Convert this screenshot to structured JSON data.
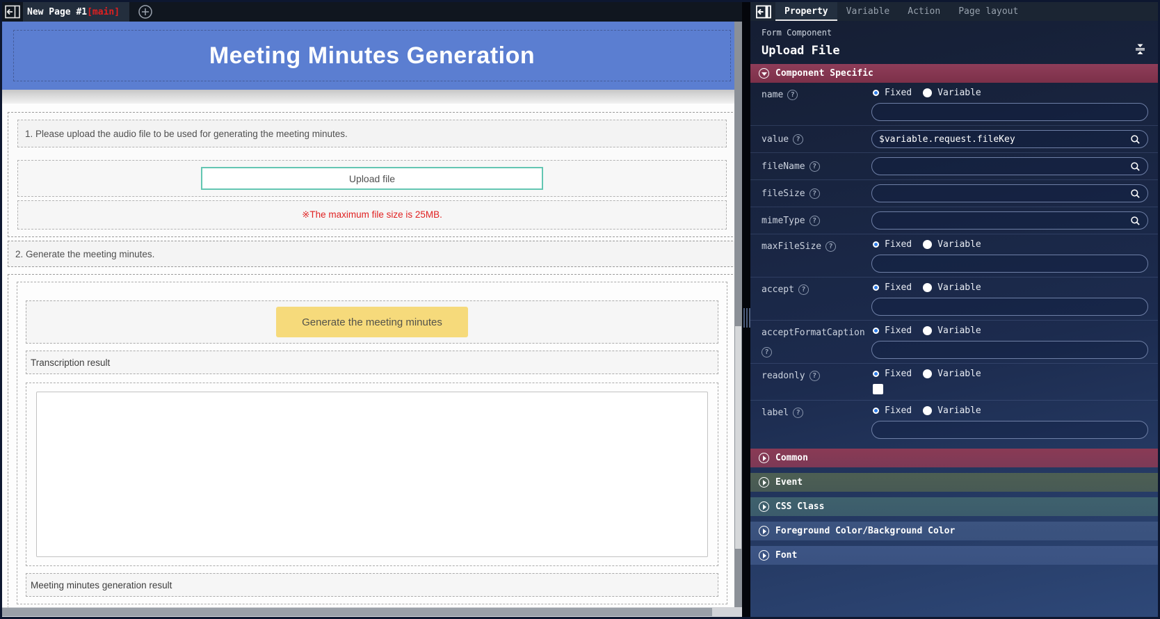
{
  "left_window": {
    "tab_bar": {
      "tab_label": "New Page #1",
      "tab_badge": "[main]"
    },
    "banner": {
      "title": "Meeting Minutes Generation",
      "background": "#5b7ed1"
    },
    "canvas": {
      "instruction_1": "1. Please upload the audio file to be used for generating the meeting minutes.",
      "upload_button_label": "Upload file",
      "file_size_note": "※The maximum file size is 25MB.",
      "instruction_2": "2. Generate the meeting minutes.",
      "generate_button_label": "Generate the meeting minutes",
      "transcription_label": "Transcription result",
      "minutes_label": "Meeting minutes generation result",
      "accent_colors": {
        "upload_border": "#63c6b2",
        "generate_bg": "#f6da7b",
        "note_text": "#e02222",
        "banner_blue": "#5b7ed1"
      }
    }
  },
  "right_panel": {
    "tabs": [
      {
        "label": "Property",
        "active": true
      },
      {
        "label": "Variable",
        "active": false
      },
      {
        "label": "Action",
        "active": false
      },
      {
        "label": "Page layout",
        "active": false
      }
    ],
    "component_type": "Form Component",
    "component_name": "Upload File",
    "radio_options": [
      "Fixed",
      "Variable"
    ],
    "component_specific": {
      "title": "Component Specific",
      "header_color": "#8e3d59",
      "fields": [
        {
          "label": "name",
          "help": true,
          "control": "fixed-variable-input",
          "selected": "Fixed",
          "value": ""
        },
        {
          "label": "value",
          "help": true,
          "control": "search-input",
          "value": "$variable.request.fileKey"
        },
        {
          "label": "fileName",
          "help": true,
          "control": "search-input",
          "value": ""
        },
        {
          "label": "fileSize",
          "help": true,
          "control": "search-input",
          "value": ""
        },
        {
          "label": "mimeType",
          "help": true,
          "control": "search-input",
          "value": ""
        },
        {
          "label": "maxFileSize",
          "help": true,
          "control": "fixed-variable-input",
          "selected": "Fixed",
          "value": ""
        },
        {
          "label": "accept",
          "help": true,
          "control": "fixed-variable-input",
          "selected": "Fixed",
          "value": ""
        },
        {
          "label": "acceptFormatCaption",
          "help": true,
          "control": "fixed-variable-input",
          "selected": "Fixed",
          "value": ""
        },
        {
          "label": "readonly",
          "help": true,
          "control": "fixed-variable-checkbox",
          "selected": "Fixed",
          "checked": false
        },
        {
          "label": "label",
          "help": true,
          "control": "fixed-variable-input",
          "selected": "Fixed",
          "value": ""
        }
      ]
    },
    "collapsed_sections": [
      {
        "label": "Common",
        "color": "#8a3a55"
      },
      {
        "label": "Event",
        "color": "#4d5f53"
      },
      {
        "label": "CSS Class",
        "color": "#3f616d"
      },
      {
        "label": "Foreground Color/Background Color",
        "color": "#3c5480"
      },
      {
        "label": "Font",
        "color": "#3d5585"
      }
    ]
  }
}
